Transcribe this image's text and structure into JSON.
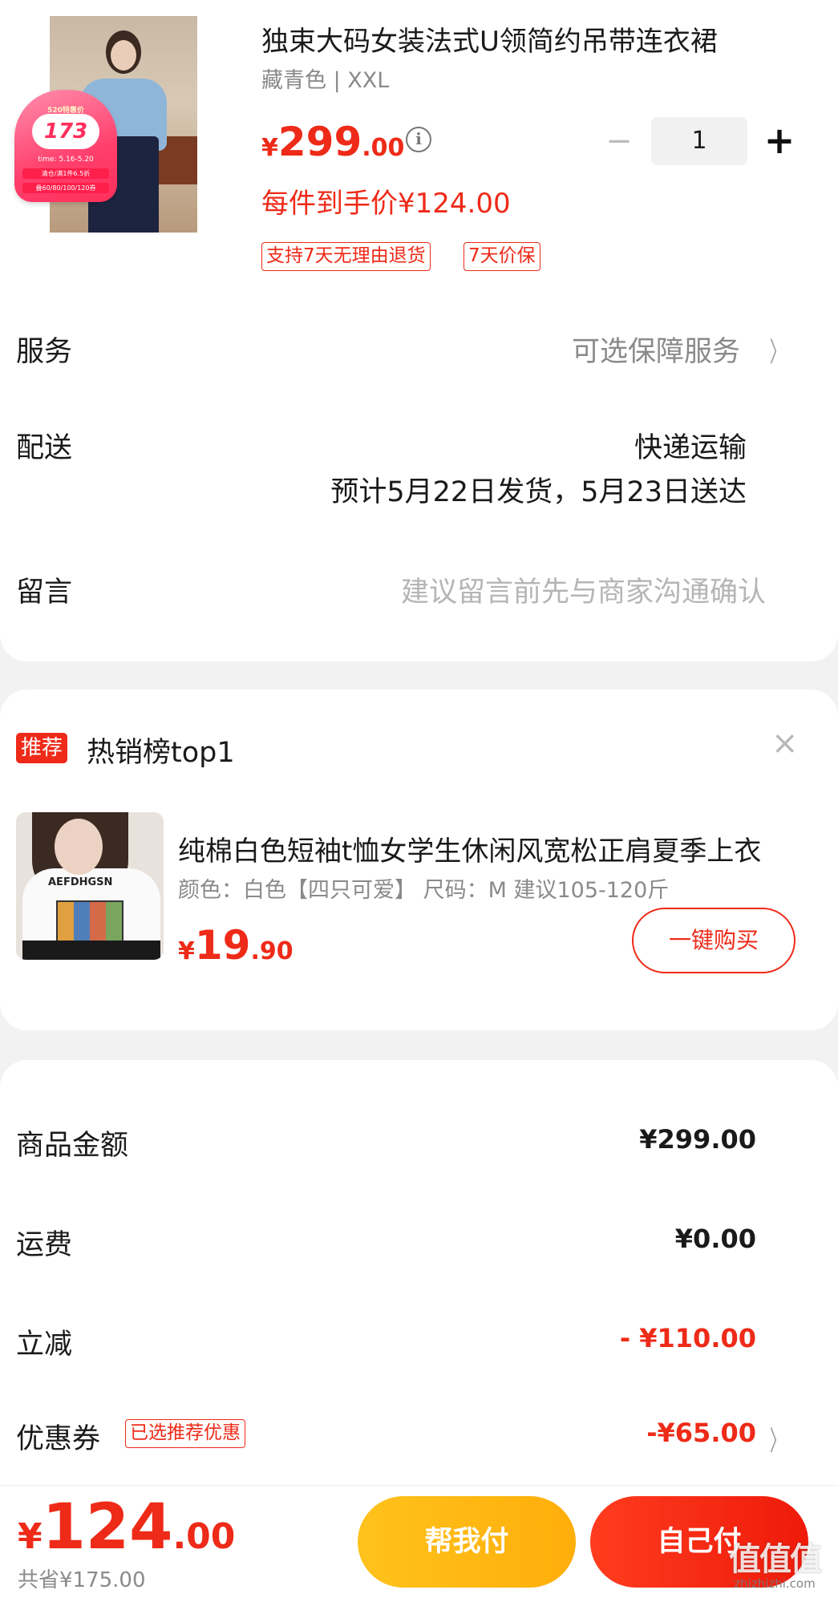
{
  "product": {
    "badge": {
      "top": "520特惠价",
      "number": "173",
      "date": "time: 5.16-5.20",
      "line1": "清仓/满1件6.5折",
      "line2": "叠60/80/100/120券"
    },
    "title": "独束大码女装法式U领简约吊带连衣裙",
    "spec": "藏青色 | XXL",
    "price": {
      "currency": "¥",
      "integer": "299",
      "decimal": ".00"
    },
    "info_icon": "info-icon",
    "quantity": {
      "minus": "−",
      "value": "1",
      "plus": "+"
    },
    "per_price": "每件到手价¥124.00",
    "tags": [
      "支持7天无理由退货",
      "7天价保"
    ]
  },
  "rows": {
    "service": {
      "label": "服务",
      "value": "可选保障服务",
      "chevron": "〉"
    },
    "delivery": {
      "label": "配送",
      "method": "快递运输",
      "estimate": "预计5月22日发货，5月23日送达"
    },
    "message": {
      "label": "留言",
      "placeholder": "建议留言前先与商家沟通确认"
    }
  },
  "recommendation": {
    "tag": "推荐",
    "title": "热销榜top1",
    "close": "×",
    "item": {
      "name": "纯棉白色短袖t恤女学生休闲风宽松正肩夏季上衣",
      "spec": "颜色：白色【四只可爱】  尺码：M 建议105-120斤",
      "price": {
        "currency": "¥",
        "integer": "19",
        "decimal": ".90"
      },
      "print_text": "AEFDHGSN",
      "buy_label": "一键购买"
    }
  },
  "summary": {
    "goods": {
      "label": "商品金额",
      "value": "¥299.00"
    },
    "shipping": {
      "label": "运费",
      "value": "¥0.00"
    },
    "discount": {
      "label": "立减",
      "value": "- ¥110.00"
    },
    "coupon": {
      "label": "优惠券",
      "tag": "已选推荐优惠",
      "value": "-¥65.00",
      "chevron": "〉"
    }
  },
  "bottom": {
    "total": {
      "currency": "¥",
      "integer": "124",
      "decimal": ".00"
    },
    "saved": "共省¥175.00",
    "help_pay": "帮我付",
    "self_pay": "自己付"
  },
  "watermark": {
    "big": "值值值",
    "small": "zhizhizhi.com"
  },
  "colors": {
    "accent": "#ee2a18",
    "gold": "#ffb812",
    "muted": "#8a8a8a"
  }
}
